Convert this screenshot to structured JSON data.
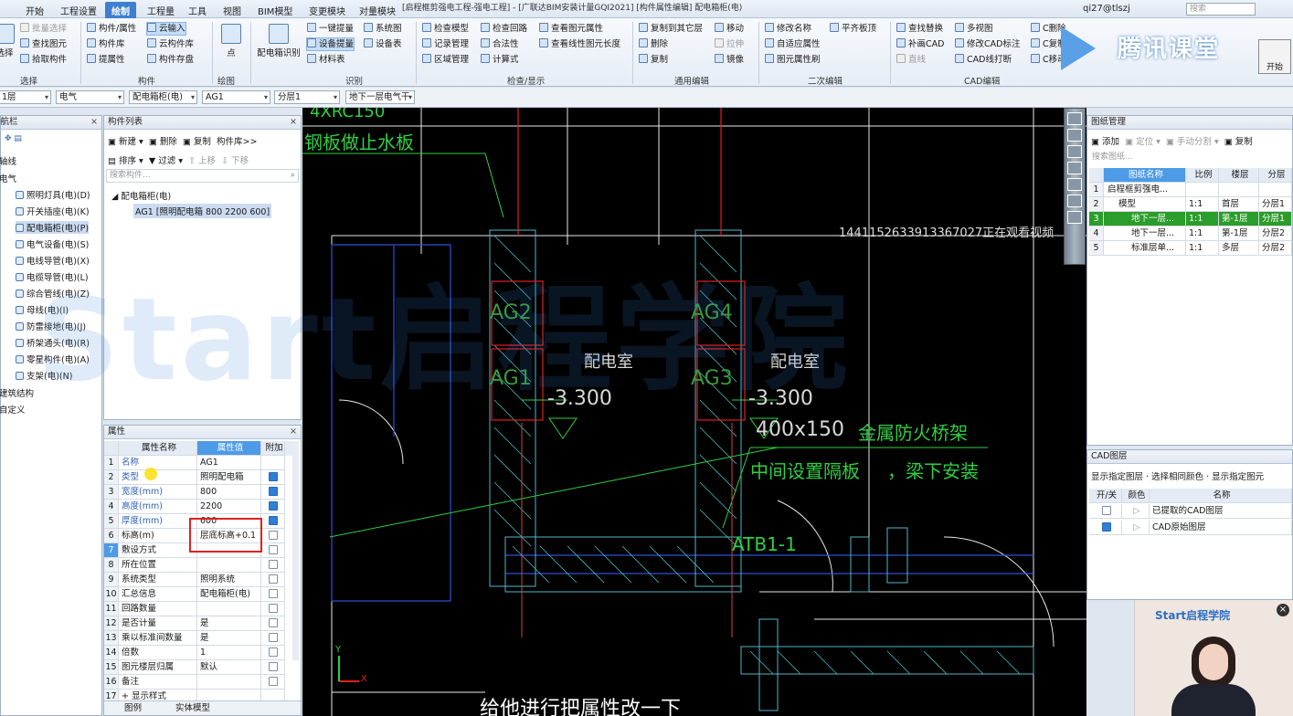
{
  "menu": {
    "tabs": [
      "开始",
      "工程设置",
      "绘制",
      "工程量",
      "工具",
      "视图",
      "BIM模型",
      "变更模块",
      "对量模块"
    ],
    "active_index": 2,
    "title_fragment": "[启程框剪强电工程-强电工程] - [广联达BIM安装计量GQI2021] [构件属性编辑] 配电箱柜(电)",
    "account": "qi27@tlszj",
    "search_placeholder": "搜索"
  },
  "ribbon": {
    "select": {
      "group": "选择",
      "items": [
        "批量选择",
        "查找图元",
        "拾取构件"
      ],
      "big": "选择"
    },
    "component": {
      "group": "构件",
      "items": [
        "构件/属性",
        "云输入",
        "构件库",
        "云构件库",
        "提属性",
        "构件存盘"
      ]
    },
    "draw": {
      "group": "绘图",
      "big": "点"
    },
    "identify": {
      "group": "识别",
      "big": "配电箱识别",
      "items": [
        "一键提量",
        "系统图",
        "设备提量",
        "设备表",
        "材料表"
      ]
    },
    "check": {
      "group": "检查/显示",
      "items": [
        "检查模型",
        "检查回路",
        "查看图元属性",
        "记录管理",
        "合法性",
        "查看线性图元长度",
        "区域管理",
        "计算式"
      ]
    },
    "edit": {
      "group": "通用编辑",
      "items": [
        "复制到其它层",
        "移动",
        "删除",
        "拉伸",
        "复制",
        "镜像"
      ]
    },
    "second": {
      "group": "二次编辑",
      "items": [
        "修改名称",
        "平齐板顶",
        "自适应属性",
        "图元属性刷"
      ]
    },
    "cad": {
      "group": "CAD编辑",
      "items": [
        "查找替换",
        "多视图",
        "C删除",
        "补画CAD",
        "修改CAD标注",
        "C复制",
        "直线",
        "CAD线打断",
        "C移动"
      ]
    }
  },
  "logo": {
    "text": "腾讯课堂",
    "start_label": "开始"
  },
  "filters": [
    "1层",
    "电气",
    "配电箱柜(电)",
    "AG1",
    "分层1",
    "地下一层电气干"
  ],
  "nav": {
    "title": "导航栏",
    "items": [
      "轴线",
      "电气",
      "照明灯具(电)(D)",
      "开关插座(电)(K)",
      "配电箱柜(电)(P)",
      "电气设备(电)(S)",
      "电线导管(电)(X)",
      "电缆导管(电)(L)",
      "综合管线(电)(Z)",
      "母线(电)(I)",
      "防雷接地(电)(J)",
      "桥架通头(电)(R)",
      "零星构件(电)(A)",
      "支架(电)(N)",
      "建筑结构",
      "自定义"
    ],
    "selected_index": 4
  },
  "complist": {
    "title": "构件列表",
    "toolbar1": [
      "新建",
      "删除",
      "复制",
      "构件库>>"
    ],
    "toolbar2": [
      "排序",
      "过滤",
      "上移",
      "下移"
    ],
    "search_placeholder": "搜索构件...",
    "group": "配电箱柜(电)",
    "item": "AG1 [照明配电箱 800 2200 600]"
  },
  "props": {
    "title": "属性",
    "headers": [
      "属性名称",
      "属性值",
      "附加"
    ],
    "rows": [
      {
        "n": "1",
        "name": "名称",
        "val": "AG1",
        "chk": null
      },
      {
        "n": "2",
        "name": "类型",
        "val": "照明配电箱",
        "chk": true
      },
      {
        "n": "3",
        "name": "宽度(mm)",
        "val": "800",
        "chk": true
      },
      {
        "n": "4",
        "name": "高度(mm)",
        "val": "2200",
        "chk": true
      },
      {
        "n": "5",
        "name": "厚度(mm)",
        "val": "600",
        "chk": true
      },
      {
        "n": "6",
        "name": "标高(m)",
        "val": "层底标高+0.1",
        "chk": false
      },
      {
        "n": "7",
        "name": "敷设方式",
        "val": "",
        "chk": false
      },
      {
        "n": "8",
        "name": "所在位置",
        "val": "",
        "chk": false
      },
      {
        "n": "9",
        "name": "系统类型",
        "val": "照明系统",
        "chk": false
      },
      {
        "n": "10",
        "name": "汇总信息",
        "val": "配电箱柜(电)",
        "chk": false
      },
      {
        "n": "11",
        "name": "回路数量",
        "val": "",
        "chk": false
      },
      {
        "n": "12",
        "name": "是否计量",
        "val": "是",
        "chk": false
      },
      {
        "n": "13",
        "name": "乘以标准间数量",
        "val": "是",
        "chk": false
      },
      {
        "n": "14",
        "name": "倍数",
        "val": "1",
        "chk": false
      },
      {
        "n": "15",
        "name": "图元楼层归属",
        "val": "默认",
        "chk": false
      },
      {
        "n": "16",
        "name": "备注",
        "val": "",
        "chk": false
      },
      {
        "n": "17",
        "name": "+ 显示样式",
        "val": "",
        "chk": null
      }
    ],
    "tabs": [
      "图例",
      "实体模型"
    ]
  },
  "drawing": {
    "title": "图纸管理",
    "toolbar": [
      "添加",
      "定位",
      "手动分割",
      "复制"
    ],
    "search_placeholder": "搜索图纸...",
    "headers": [
      "图纸名称",
      "比例",
      "楼层",
      "分层"
    ],
    "rows": [
      {
        "n": "1",
        "name": "启程框剪强电...",
        "ratio": "",
        "floor": "",
        "layer": ""
      },
      {
        "n": "2",
        "name": "模型",
        "ratio": "1:1",
        "floor": "首层",
        "layer": "分层1"
      },
      {
        "n": "3",
        "name": "地下一层...",
        "ratio": "1:1",
        "floor": "第-1层",
        "layer": "分层1"
      },
      {
        "n": "4",
        "name": "地下一层...",
        "ratio": "1:1",
        "floor": "第-1层",
        "layer": "分层2"
      },
      {
        "n": "5",
        "name": "标准层单...",
        "ratio": "1:1",
        "floor": "多层",
        "layer": "分层2"
      }
    ],
    "selected_index": 2
  },
  "cadlayer": {
    "title": "CAD图层",
    "toolbar": "显示指定图层 · 选择相同颜色 · 显示指定图元",
    "headers": [
      "开/关",
      "颜色",
      "名称"
    ],
    "rows": [
      "已提取的CAD图层",
      "CAD原始图层"
    ]
  },
  "canvas": {
    "labels": {
      "top1": "4XRC150",
      "top2": "钢板做止水板",
      "ag2": "AG2",
      "ag1": "AG1",
      "ag4": "AG4",
      "ag3": "AG3",
      "room1": "配电室",
      "room2": "配电室",
      "elev1": "-3.300",
      "elev2": "-3.300",
      "tray": "400x150",
      "tray_desc": "金属防火桥架",
      "tray_note1": "中间设置隔板",
      "tray_note2": "，梁下安装",
      "atb": "ATB1-1",
      "axis_y": "Y",
      "axis_x": "X"
    },
    "watching": "1441152633913367027正在观看视频",
    "subtitle": "给他进行把属性改一下"
  },
  "watermark": "Start启程学院",
  "presenter_logo": "Start启程学院"
}
